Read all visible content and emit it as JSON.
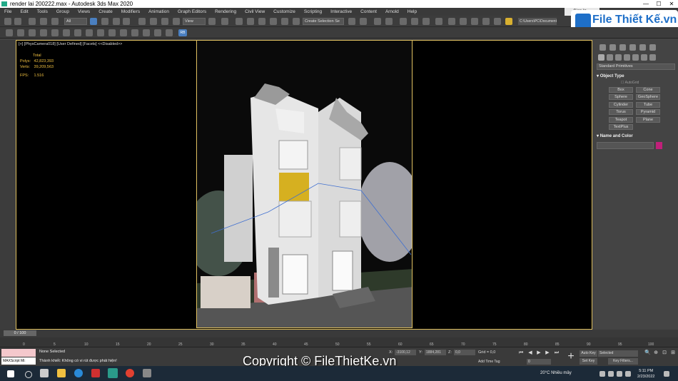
{
  "window": {
    "title": "render lai 200222.max - Autodesk 3ds Max 2020",
    "minimize": "—",
    "maximize": "☐",
    "close": "✕"
  },
  "menu": [
    "File",
    "Edit",
    "Tools",
    "Group",
    "Views",
    "Create",
    "Modifiers",
    "Animation",
    "Graph Editors",
    "Rendering",
    "Civil View",
    "Customize",
    "Scripting",
    "Interactive",
    "Content",
    "Arnold",
    "Help"
  ],
  "sign_in": "Sign In",
  "toolbar": {
    "selection_filter": "All",
    "view_dropdown": "View",
    "selection_set": "Create Selection Se",
    "project_path": "C:\\Users\\PC\\Documents\\3ds Max 2020",
    "rb_label": "RB"
  },
  "logo": {
    "text": "File Thiết Kế.vn"
  },
  "viewport": {
    "label": "[+] [PhysCamera018] [User Defined] [Facets]  <<Disabled>>",
    "stats": {
      "total_label": "Total",
      "polys_label": "Polys:",
      "polys_value": "42,823,393",
      "verts_label": "Verts:",
      "verts_value": "39,209,563",
      "fps_label": "FPS:",
      "fps_value": "1.516"
    }
  },
  "command_panel": {
    "category": "Standard Primitives",
    "object_type_header": "Object Type",
    "autogrid": "AutoGrid",
    "primitives": [
      "Box",
      "Cone",
      "Sphere",
      "GeoSphere",
      "Cylinder",
      "Tube",
      "Torus",
      "Pyramid",
      "Teapot",
      "Plane",
      "TextPlus"
    ],
    "name_color_header": "Name and Color",
    "color": "#c0207a"
  },
  "timeline": {
    "frame_indicator": "0 / 100",
    "ticks": [
      "0",
      "5",
      "10",
      "15",
      "20",
      "25",
      "30",
      "35",
      "40",
      "45",
      "50",
      "55",
      "60",
      "65",
      "70",
      "75",
      "80",
      "85",
      "90",
      "95",
      "100"
    ]
  },
  "status": {
    "maxscript": "MAXScript Mi:",
    "selection": "None Selected",
    "message": "Thành khiết: Không có vi rút được phát hiện!",
    "x_label": "X:",
    "x_value": "-3100,12",
    "y_label": "Y:",
    "y_value": "1884,281",
    "z_label": "Z:",
    "z_value": "0,0",
    "grid": "Grid = 0,0",
    "add_time_tag": "Add Time Tag",
    "auto_key": "Auto Key",
    "set_key": "Set Key",
    "selected": "Selected",
    "key_filters": "Key Filters...",
    "frame_number": "0"
  },
  "watermark": "Copyright © FileThietKe.vn",
  "taskbar": {
    "weather": "20°C  Nhiều mây",
    "time": "5:11 PM",
    "date": "2/23/2022"
  }
}
